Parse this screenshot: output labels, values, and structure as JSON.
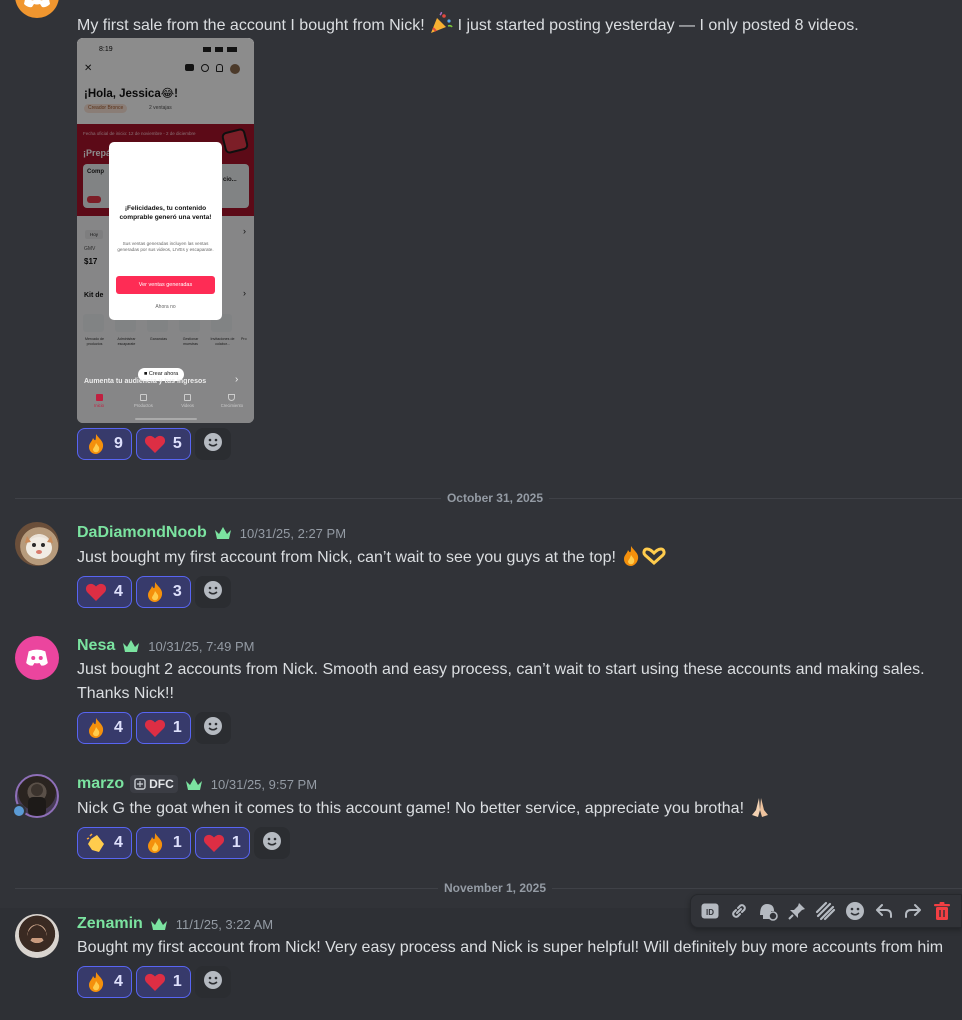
{
  "messages": {
    "first": {
      "text": "My first sale from the account I bought from Nick! 🎉 I just started posting yesterday — I only posted 8 videos.",
      "text_a": "My first sale from the account I bought from Nick! ",
      "text_b": " I just started posting yesterday — I only posted 8 videos.",
      "reactions": [
        {
          "emoji": "fire",
          "count": "9"
        },
        {
          "emoji": "heart",
          "count": "5"
        }
      ]
    },
    "dadiamond": {
      "name": "DaDiamondNoob",
      "timestamp": "10/31/25, 2:27 PM",
      "text": "Just bought my first account from Nick, can’t wait to see you guys at the top! ",
      "reactions": [
        {
          "emoji": "heart",
          "count": "4"
        },
        {
          "emoji": "fire",
          "count": "3"
        }
      ]
    },
    "nesa": {
      "name": "Nesa",
      "timestamp": "10/31/25, 7:49 PM",
      "text": "Just bought 2 accounts from Nick. Smooth and easy process, can’t wait to start using these accounts and making sales. Thanks Nick!!",
      "reactions": [
        {
          "emoji": "fire",
          "count": "4"
        },
        {
          "emoji": "heart",
          "count": "1"
        }
      ]
    },
    "marzo": {
      "name": "marzo",
      "tag": "DFC",
      "timestamp": "10/31/25, 9:57 PM",
      "text": "Nick G the goat when it comes to this account game! No better service, appreciate you brotha! ",
      "reactions": [
        {
          "emoji": "clap",
          "count": "4"
        },
        {
          "emoji": "fire",
          "count": "1"
        },
        {
          "emoji": "heart",
          "count": "1"
        }
      ]
    },
    "zenamin": {
      "name": "Zenamin",
      "timestamp": "11/1/25, 3:22 AM",
      "text": "Bought my first account from Nick! Very easy process and Nick is super helpful! Will definitely buy more accounts from him",
      "reactions": [
        {
          "emoji": "fire",
          "count": "4"
        },
        {
          "emoji": "heart",
          "count": "1"
        }
      ]
    }
  },
  "dividers": {
    "oct31": "October 31, 2025",
    "nov1": "November 1, 2025"
  },
  "phone": {
    "time": "8:19",
    "greeting": "¡Hola, Jessica😂!",
    "badge": "Creador Bronce",
    "sales_count": "2 ventajas",
    "banner_small": "Fecha oficial de inicio: 12 de noviembre - 2 de diciembre",
    "banner_title": "¡Prepá",
    "card_label": "Comp",
    "card_side": "cio...",
    "tab_today": "Hoy",
    "gmv_label": "GMV",
    "gmv_value": "$17",
    "kit_label": "Kit de",
    "tools": [
      "Mercado de productos",
      "Administrar escaparate",
      "Ganancias",
      "Gestionar muestras",
      "Invitaciones de colabor...",
      "Pro"
    ],
    "modal_title": "¡Felicidades, tu contenido comprable generó una venta!",
    "modal_body": "Sus ventas generadas incluyen las ventas generadas por sus videos, LIVEs y escaparate.",
    "modal_button": "Ver ventas generadas",
    "modal_dismiss": "Ahora no",
    "create_now": "Crear ahora",
    "grow_label": "Aumenta tu audiencia y tus ingresos",
    "nav": [
      "Inicio",
      "Productos",
      "Videos",
      "Crecimiento"
    ],
    "accent_color": "#fe2c55"
  },
  "colors": {
    "background": "#313338",
    "username": "#7be3a0",
    "reaction_bg": "#373a6b",
    "reaction_border": "#5865f2",
    "discord_blurple": "#5865f2",
    "nesa_avatar": "#eb459e",
    "delete_red": "#f23f43"
  },
  "toolbar": {
    "icons": [
      "app-id-icon",
      "copy-link-icon",
      "thread-icon",
      "pin-icon",
      "forward-icon",
      "add-reaction-icon",
      "reply-icon",
      "share-icon",
      "delete-icon"
    ]
  }
}
